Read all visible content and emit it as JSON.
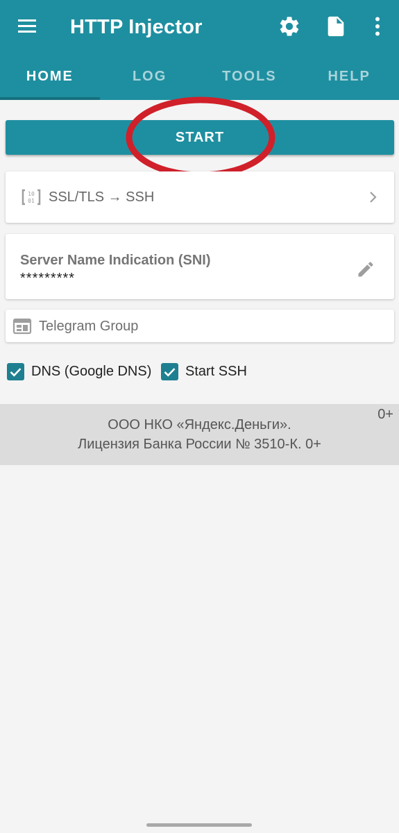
{
  "app": {
    "title": "HTTP Injector"
  },
  "icons": {
    "menu": "hamburger-menu-icon",
    "settings": "gear-icon",
    "file": "document-icon",
    "more": "more-vertical-icon",
    "mode": "binary-code-icon",
    "chevron": "chevron-right-icon",
    "edit": "pencil-icon",
    "telegram": "web-asset-icon",
    "check": "checkmark-icon"
  },
  "tabs": [
    {
      "label": "HOME",
      "active": true
    },
    {
      "label": "LOG",
      "active": false
    },
    {
      "label": "TOOLS",
      "active": false
    },
    {
      "label": "HELP",
      "active": false
    }
  ],
  "start": {
    "label": "START"
  },
  "mode": {
    "label": "SSL/TLS → SSH"
  },
  "sni": {
    "label": "Server Name Indication (SNI)",
    "value": "*********"
  },
  "telegram": {
    "label": "Telegram Group"
  },
  "checks": [
    {
      "label": "DNS (Google DNS)",
      "checked": true
    },
    {
      "label": "Start SSH",
      "checked": true
    }
  ],
  "banner": {
    "line1": "ООО НКО «Яндекс.Деньги».",
    "line2": "Лицензия Банка России № 3510-К. 0+",
    "age": "0+"
  },
  "colors": {
    "primary": "#1e8fa0",
    "checkbox": "#1e7f90",
    "highlight_ring": "#d0202a",
    "background": "#f4f4f4"
  }
}
